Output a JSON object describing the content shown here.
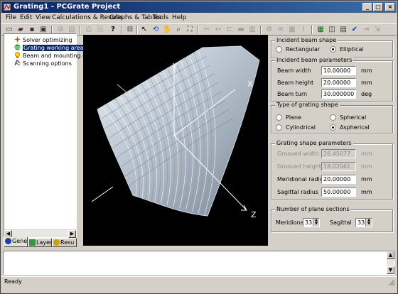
{
  "window": {
    "title": "Grating1 - PCGrate Project"
  },
  "menu": [
    "File",
    "Edit",
    "View",
    "Calculations & Results",
    "Graphs & Tables",
    "Tools",
    "Help"
  ],
  "tree": {
    "items": [
      {
        "label": "Solver optimizing",
        "icon": "solver-icon",
        "selected": false
      },
      {
        "label": "Grating working area",
        "icon": "grating-icon",
        "selected": true
      },
      {
        "label": "Beam and mounting g",
        "icon": "beam-icon",
        "selected": false
      },
      {
        "label": "Scanning options",
        "icon": "scan-icon",
        "selected": false
      }
    ]
  },
  "left_tabs": [
    {
      "label": "Gener",
      "active": true
    },
    {
      "label": "Layer",
      "active": false
    },
    {
      "label": "Resu",
      "active": false
    }
  ],
  "viewport": {
    "axis_x": "X",
    "axis_y": "Y",
    "axis_z": "Z"
  },
  "incident_shape": {
    "title": "Incident beam shape",
    "options": [
      "Rectangular",
      "Elliptical"
    ],
    "selected": "Elliptical"
  },
  "beam_params": {
    "title": "Incident beam parameters",
    "fields": [
      {
        "label": "Beam width",
        "value": "10.00000",
        "unit": "mm"
      },
      {
        "label": "Beam height",
        "value": "20.00000",
        "unit": "mm"
      },
      {
        "label": "Beam turn",
        "value": "30.000000",
        "unit": "deg"
      }
    ]
  },
  "grating_type": {
    "title": "Type of grating shape",
    "options": [
      "Plane",
      "Spherical",
      "Cylindrical",
      "Aspherical"
    ],
    "selected": "Aspherical"
  },
  "shape_params": {
    "title": "Grating shape parameters",
    "fields": [
      {
        "label": "Grooved width",
        "value": "26.45077",
        "unit": "mm",
        "disabled": true
      },
      {
        "label": "Grooved height",
        "value": "18.02061",
        "unit": "mm",
        "disabled": true
      },
      {
        "label": "Meridional radius",
        "value": "20.00000",
        "unit": "mm",
        "disabled": false
      },
      {
        "label": "Sagittal radius",
        "value": "50.00000",
        "unit": "mm",
        "disabled": false
      }
    ]
  },
  "plane_sections": {
    "title": "Number of plane sections",
    "meridional_label": "Meridional",
    "meridional_value": "33",
    "sagittal_label": "Sagittal",
    "sagittal_value": "33"
  },
  "status": {
    "text": "Ready"
  }
}
